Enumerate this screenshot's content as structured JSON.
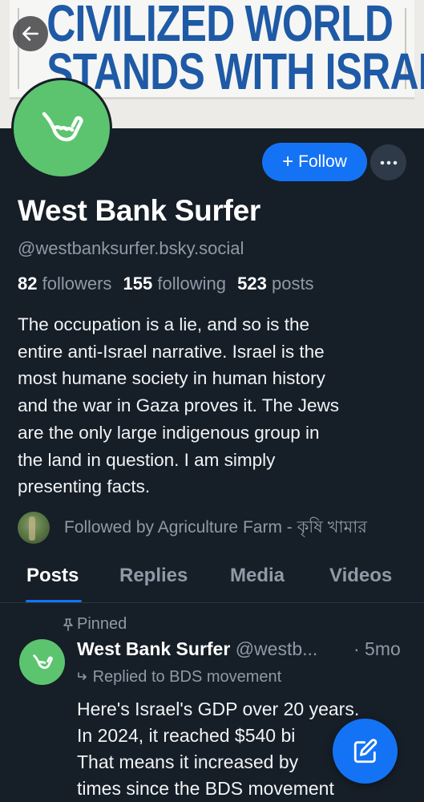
{
  "banner": {
    "line1": "CIVILIZED WORLD",
    "line2": "STANDS WITH ISRAEL"
  },
  "header": {
    "back_icon": "arrow-left-icon",
    "follow_label": "Follow",
    "follow_icon": "plus-icon",
    "more_icon": "ellipsis-icon"
  },
  "profile": {
    "avatar_icon": "shaka-hand-icon",
    "avatar_color": "#5cc46f",
    "display_name": "West Bank Surfer",
    "handle": "@westbanksurfer.bsky.social",
    "followers_count": "82",
    "followers_label": "followers",
    "following_count": "155",
    "following_label": "following",
    "posts_count": "523",
    "posts_label": "posts",
    "bio_lines": [
      "The occupation is a lie, and so is the",
      "entire anti-Israel narrative. Israel is the",
      "most humane society in human history",
      "and the war in Gaza proves it. The Jews",
      "are the only large indigenous group in",
      "the land in question.  I am simply",
      "presenting facts."
    ],
    "followed_by": "Followed by Agriculture Farm - কৃষি খামার"
  },
  "tabs": [
    {
      "label": "Posts",
      "active": true
    },
    {
      "label": "Replies",
      "active": false
    },
    {
      "label": "Media",
      "active": false
    },
    {
      "label": "Videos",
      "active": false
    }
  ],
  "post": {
    "pinned_label": "Pinned",
    "pin_icon": "pin-icon",
    "author_name": "West Bank Surfer",
    "author_handle": "@westb...",
    "time": "· 5mo",
    "replied_to": "Replied to BDS movement",
    "reply_icon": "reply-arrow-icon",
    "body_lines": [
      "Here's Israel's GDP over 20 years.",
      "In 2024, it reached $540 bi",
      "That means it increased by",
      "times since the BDS movement"
    ]
  },
  "fab": {
    "icon": "compose-icon"
  },
  "colors": {
    "background": "#161e27",
    "accent": "#1473f5",
    "muted_text": "#8f9aa7",
    "banner_text": "#1e5aa6"
  }
}
